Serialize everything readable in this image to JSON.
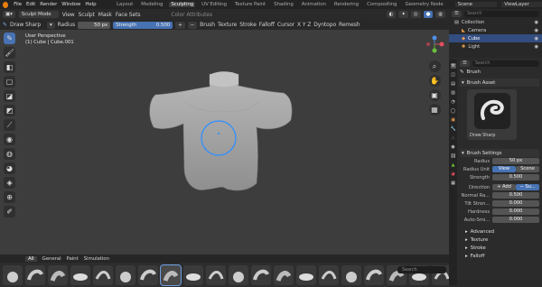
{
  "menu": {
    "items": [
      "File",
      "Edit",
      "Render",
      "Window",
      "Help"
    ]
  },
  "workspaces": {
    "tabs": [
      "Layout",
      "Modeling",
      "Sculpting",
      "UV Editing",
      "Texture Paint",
      "Shading",
      "Animation",
      "Rendering",
      "Compositing",
      "Geometry Node"
    ],
    "active": "Sculpting"
  },
  "scene": {
    "label": "Scene",
    "view_layer": "ViewLayer"
  },
  "header1": {
    "mode": "Sculpt Mode",
    "menus": [
      "View",
      "Sculpt",
      "Mask",
      "Face Sets"
    ],
    "color_attr": "Color Attributes"
  },
  "header2": {
    "brush": "Draw Sharp",
    "radius_label": "Radius",
    "radius_value": "50 px",
    "strength_label": "Strength",
    "strength_value": "0.500",
    "brush_menu": "Brush",
    "texture_menu": "Texture",
    "stroke_menu": "Stroke",
    "falloff_menu": "Falloff",
    "cursor_menu": "Cursor",
    "axes": "X Y Z",
    "dyntopo": "Dyntopo",
    "remesh": "Remesh"
  },
  "viewport": {
    "view_name": "User Perspective",
    "object_name": "(1) Cube | Cube.001"
  },
  "shelf": {
    "tabs": [
      "All",
      "General",
      "Paint",
      "Simulation"
    ],
    "active_tab": "All",
    "search_placeholder": "Search",
    "brush_count": 22,
    "active_index": 7
  },
  "outliner": {
    "search_placeholder": "Search",
    "collection": "Collection",
    "items": [
      "Camera",
      "Cube",
      "Light"
    ]
  },
  "properties": {
    "search_placeholder": "Search",
    "brush_title": "Brush",
    "brush_asset_header": "Brush Asset",
    "brush_asset_name": "Draw Sharp",
    "brush_settings_header": "Brush Settings",
    "radius_label": "Radius",
    "radius_value": "50 px",
    "radius_unit_label": "Radius Unit",
    "radius_unit_view": "View",
    "radius_unit_scene": "Scene",
    "strength_label": "Strength",
    "strength_value": "0.500",
    "direction_label": "Direction",
    "direction_add": "+ Add",
    "direction_sub": "− Su...",
    "normal_radius_label": "Normal Ra...",
    "normal_radius_value": "0.500",
    "tilt_strength_label": "Tilt Stren...",
    "tilt_strength_value": "0.000",
    "hardness_label": "Hardness",
    "hardness_value": "0.000",
    "auto_smooth_label": "Auto-Smi...",
    "auto_smooth_value": "0.000",
    "collapsed": [
      "Advanced",
      "Texture",
      "Stroke",
      "Falloff"
    ]
  },
  "colors": {
    "accent": "#4772b3",
    "brush_circle": "#2f8fff"
  }
}
